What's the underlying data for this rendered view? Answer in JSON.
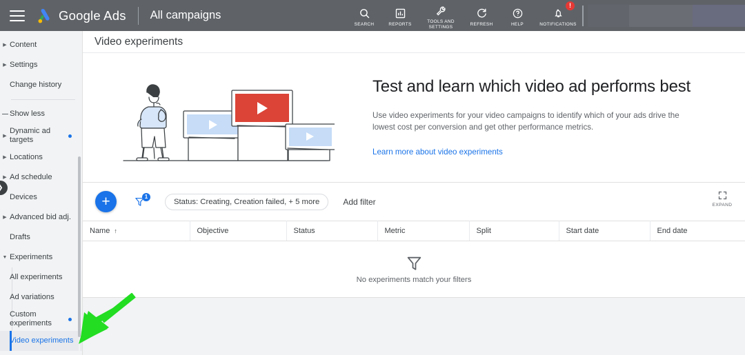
{
  "topbar": {
    "menu_icon": "hamburger-menu-icon",
    "logo_icon": "google-ads-logo-icon",
    "brand": "Google Ads",
    "account": "All campaigns",
    "icons": [
      {
        "name": "search-icon",
        "label": "SEARCH"
      },
      {
        "name": "reports-icon",
        "label": "REPORTS"
      },
      {
        "name": "tools-settings-icon",
        "label": "TOOLS AND\nSETTINGS"
      },
      {
        "name": "refresh-icon",
        "label": "REFRESH"
      },
      {
        "name": "help-icon",
        "label": "HELP"
      },
      {
        "name": "notifications-icon",
        "label": "NOTIFICATIONS"
      }
    ],
    "notification_badge": "!"
  },
  "sidebar": {
    "items": [
      {
        "label": "Content",
        "caret": "right",
        "level": 0,
        "dot": false,
        "selected": false
      },
      {
        "label": "Settings",
        "caret": "right",
        "level": 0,
        "dot": false,
        "selected": false
      },
      {
        "label": "Change history",
        "caret": "none",
        "level": 0,
        "dot": false,
        "selected": false
      },
      {
        "label": "Show less",
        "caret": "dash",
        "level": 0,
        "dot": false,
        "selected": false
      },
      {
        "label": "Dynamic ad targets",
        "caret": "right",
        "level": 0,
        "dot": true,
        "selected": false
      },
      {
        "label": "Locations",
        "caret": "right",
        "level": 0,
        "dot": false,
        "selected": false
      },
      {
        "label": "Ad schedule",
        "caret": "right",
        "level": 0,
        "dot": false,
        "selected": false
      },
      {
        "label": "Devices",
        "caret": "none",
        "level": 0,
        "dot": false,
        "selected": false
      },
      {
        "label": "Advanced bid adj.",
        "caret": "right",
        "level": 0,
        "dot": false,
        "selected": false
      },
      {
        "label": "Drafts",
        "caret": "none",
        "level": 0,
        "dot": false,
        "selected": false
      },
      {
        "label": "Experiments",
        "caret": "down",
        "level": 0,
        "dot": false,
        "selected": false
      },
      {
        "label": "All experiments",
        "caret": "none",
        "level": 1,
        "dot": false,
        "selected": false
      },
      {
        "label": "Ad variations",
        "caret": "none",
        "level": 1,
        "dot": false,
        "selected": false
      },
      {
        "label": "Custom experiments",
        "caret": "none",
        "level": 1,
        "dot": true,
        "selected": false
      },
      {
        "label": "Video experiments",
        "caret": "none",
        "level": 1,
        "dot": false,
        "selected": true
      }
    ],
    "collapse_handle_icon": "chevron-right-icon"
  },
  "page": {
    "title": "Video experiments"
  },
  "promo": {
    "illustration": "video-experiments-illustration",
    "heading": "Test and learn which video ad performs best",
    "body": "Use video experiments for your video campaigns to identify which of your ads drive the lowest cost per conversion and get other performance metrics.",
    "link": "Learn more about video experiments"
  },
  "toolbar": {
    "add_button": "+",
    "filter_icon": "filter-funnel-icon",
    "filter_badge": "1",
    "filter_chip": "Status: Creating, Creation failed, + 5 more",
    "add_filter": "Add filter",
    "expand_icon": "expand-fullscreen-icon",
    "expand_label": "EXPAND"
  },
  "table": {
    "columns": [
      {
        "label": "Name",
        "sorted": true,
        "sort_dir": "asc"
      },
      {
        "label": "Objective",
        "sorted": false
      },
      {
        "label": "Status",
        "sorted": false
      },
      {
        "label": "Metric",
        "sorted": false
      },
      {
        "label": "Split",
        "sorted": false
      },
      {
        "label": "Start date",
        "sorted": false
      },
      {
        "label": "End date",
        "sorted": false
      }
    ],
    "sort_arrow": "↑",
    "rows": [],
    "empty_icon": "filter-funnel-icon",
    "empty_message": "No experiments match your filters"
  },
  "annotation": {
    "arrow": "green-pointer-arrow",
    "color": "#22dd22"
  },
  "colors": {
    "topbar_bg": "#5f6368",
    "accent_blue": "#1a73e8",
    "page_bg": "#f1f3f4",
    "card_bg": "#ffffff",
    "text_primary": "#3c4043",
    "text_secondary": "#5f6368",
    "badge_red": "#e53935",
    "video_red": "#db4437",
    "video_blue": "#c6dcf7"
  }
}
